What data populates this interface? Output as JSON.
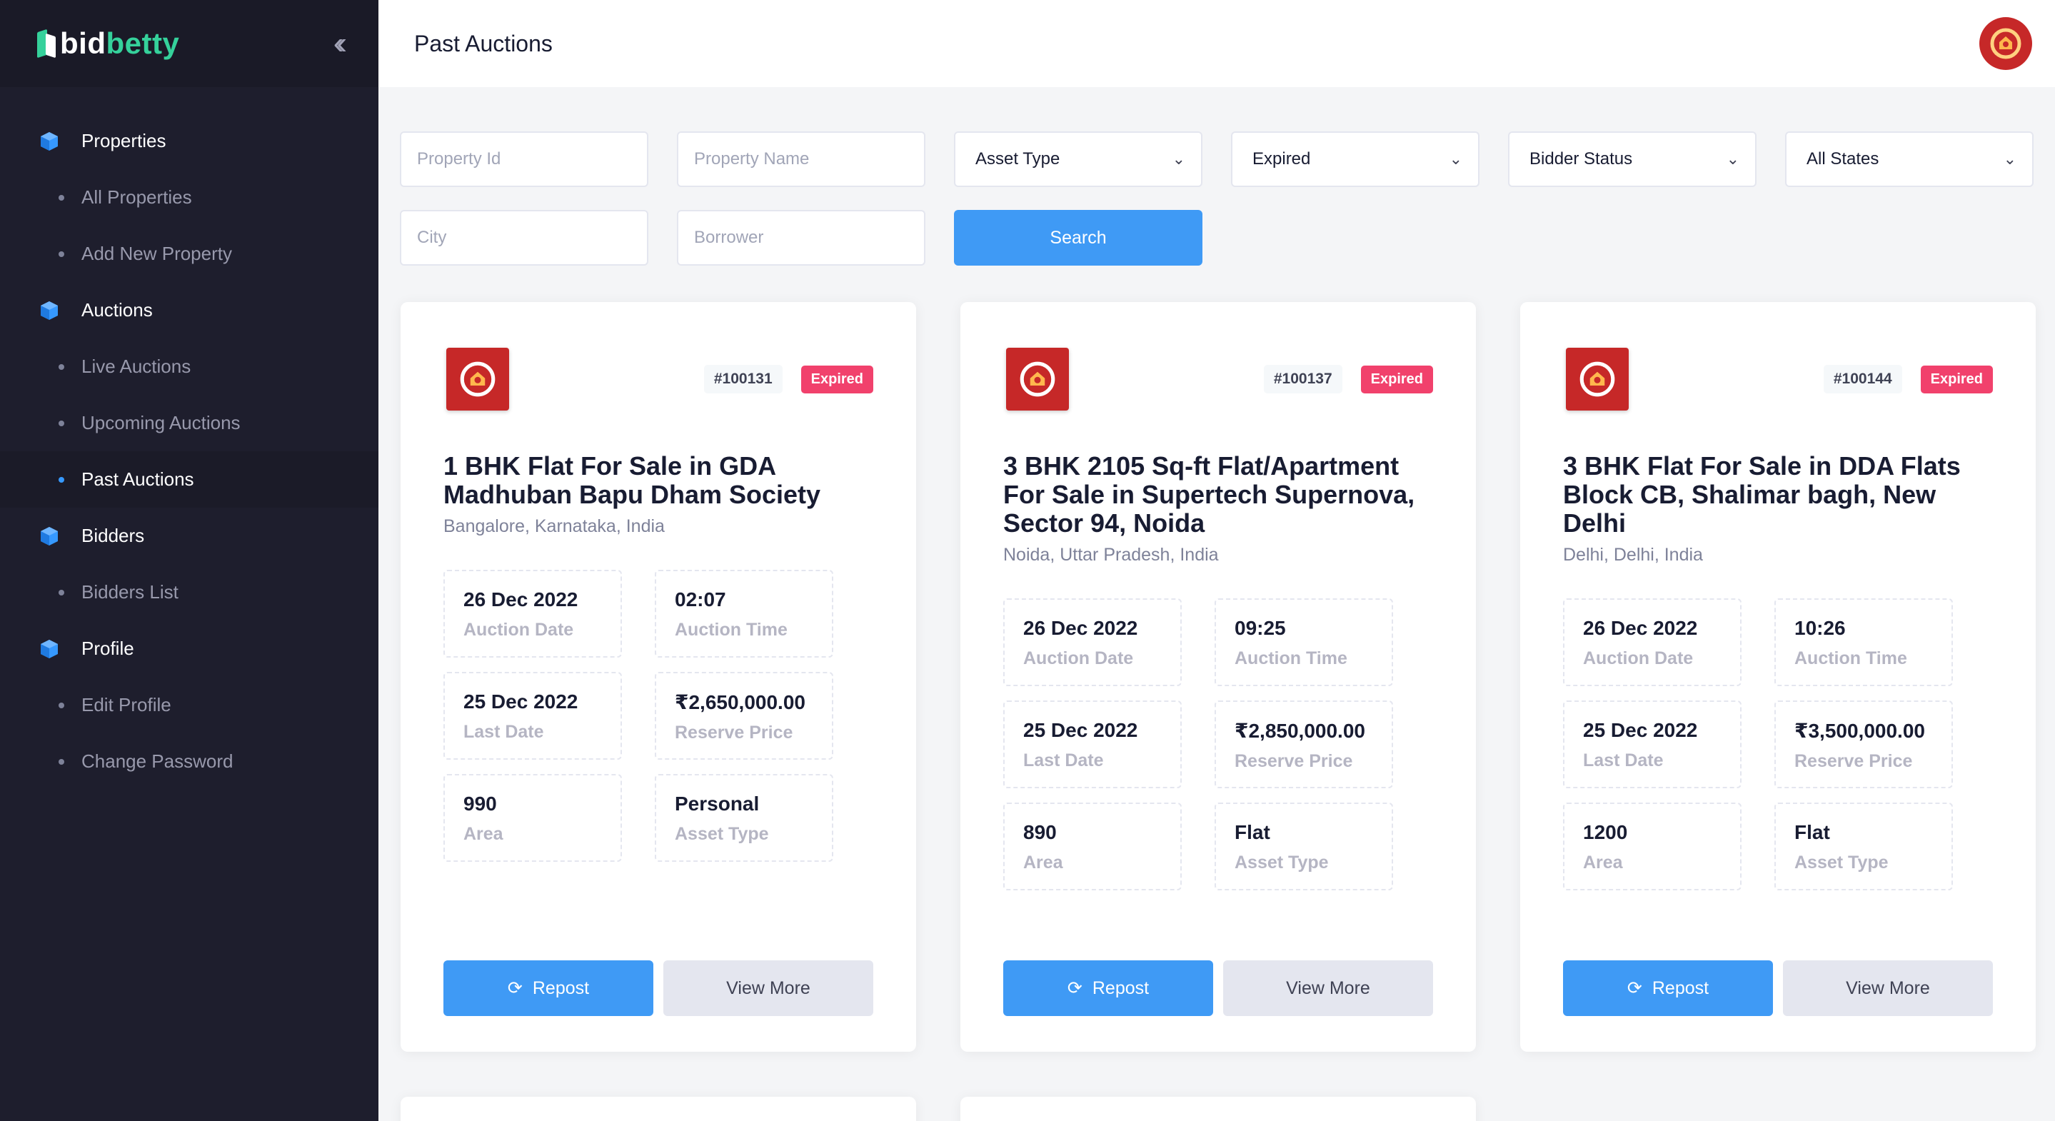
{
  "brand": {
    "logo_part1": "bid",
    "logo_part2": "betty"
  },
  "header": {
    "title": "Past Auctions"
  },
  "sidebar": {
    "sections": [
      {
        "label": "Properties",
        "items": [
          {
            "label": "All Properties"
          },
          {
            "label": "Add New Property"
          }
        ]
      },
      {
        "label": "Auctions",
        "items": [
          {
            "label": "Live Auctions"
          },
          {
            "label": "Upcoming Auctions"
          },
          {
            "label": "Past Auctions",
            "active": true
          }
        ]
      },
      {
        "label": "Bidders",
        "items": [
          {
            "label": "Bidders List"
          }
        ]
      },
      {
        "label": "Profile",
        "items": [
          {
            "label": "Edit Profile"
          },
          {
            "label": "Change Password"
          }
        ]
      }
    ]
  },
  "filters": {
    "property_id_placeholder": "Property Id",
    "property_name_placeholder": "Property Name",
    "asset_type": "Asset Type",
    "status": "Expired",
    "bidder_status": "Bidder Status",
    "state": "All States",
    "city_placeholder": "City",
    "borrower_placeholder": "Borrower",
    "search_label": "Search"
  },
  "cards": [
    {
      "id": "#100131",
      "status": "Expired",
      "title_lines": [
        "1 BHK Flat For Sale in GDA",
        "Madhuban Bapu Dham Society"
      ],
      "location": "Bangalore, Karnataka, India",
      "auction_date": "26 Dec 2022",
      "auction_time": "02:07",
      "last_date": "25 Dec 2022",
      "reserve_price": "₹2,650,000.00",
      "area": "990",
      "asset_type": "Personal"
    },
    {
      "id": "#100137",
      "status": "Expired",
      "title_lines": [
        "3 BHK 2105 Sq-ft Flat/Apartment",
        "For Sale in Supertech Supernova,",
        "Sector 94, Noida"
      ],
      "location": "Noida, Uttar Pradesh, India",
      "auction_date": "26 Dec 2022",
      "auction_time": "09:25",
      "last_date": "25 Dec 2022",
      "reserve_price": "₹2,850,000.00",
      "area": "890",
      "asset_type": "Flat"
    },
    {
      "id": "#100144",
      "status": "Expired",
      "title_lines": [
        "3 BHK Flat For Sale in DDA Flats",
        "Block CB, Shalimar bagh, New",
        "Delhi"
      ],
      "location": "Delhi, Delhi, India",
      "auction_date": "26 Dec 2022",
      "auction_time": "10:26",
      "last_date": "25 Dec 2022",
      "reserve_price": "₹3,500,000.00",
      "area": "1200",
      "asset_type": "Flat"
    }
  ],
  "labels": {
    "auction_date": "Auction Date",
    "auction_time": "Auction Time",
    "last_date": "Last Date",
    "reserve_price": "Reserve Price",
    "area": "Area",
    "asset_type": "Asset Type",
    "repost": "Repost",
    "view_more": "View More"
  },
  "colors": {
    "accent": "#3f9af5",
    "expired": "#f1416c",
    "sidebar": "#1e1e2d",
    "brand_green": "#35d19b"
  }
}
